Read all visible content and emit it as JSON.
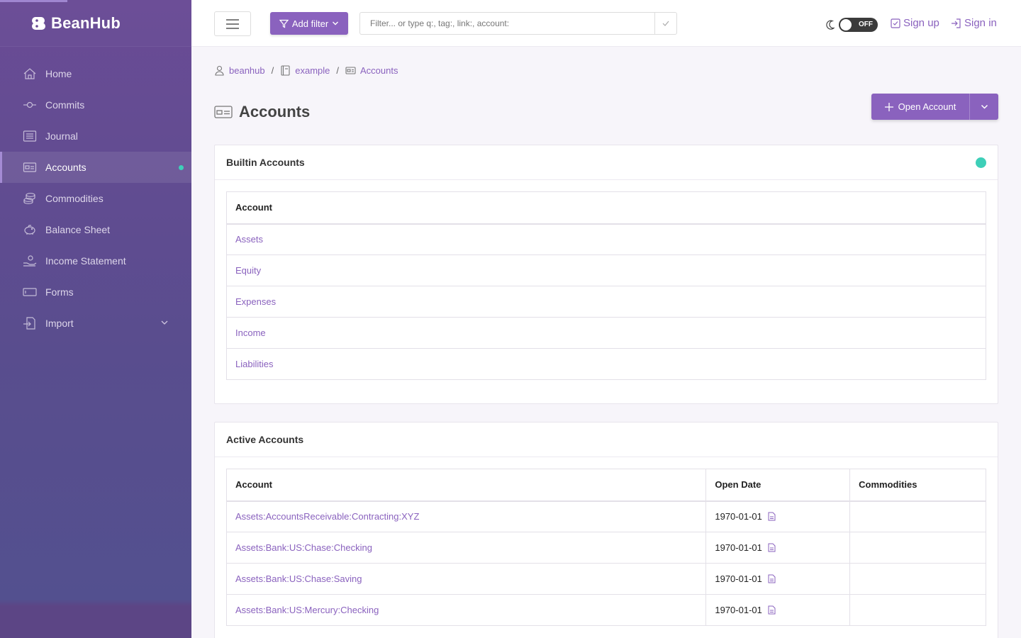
{
  "brand": {
    "name": "BeanHub"
  },
  "sidebar": {
    "items": [
      {
        "label": "Home",
        "icon": "home-icon"
      },
      {
        "label": "Commits",
        "icon": "commit-icon"
      },
      {
        "label": "Journal",
        "icon": "journal-icon"
      },
      {
        "label": "Accounts",
        "icon": "accounts-icon",
        "active": true
      },
      {
        "label": "Commodities",
        "icon": "coins-icon"
      },
      {
        "label": "Balance Sheet",
        "icon": "piggy-bank-icon"
      },
      {
        "label": "Income Statement",
        "icon": "hand-coin-icon"
      },
      {
        "label": "Forms",
        "icon": "form-icon"
      },
      {
        "label": "Import",
        "icon": "import-icon"
      }
    ]
  },
  "topbar": {
    "add_filter_label": "Add filter",
    "filter_placeholder": "Filter... or type q:, tag:, link:, account:",
    "theme_toggle_text": "OFF",
    "sign_up": "Sign up",
    "sign_in": "Sign in"
  },
  "breadcrumb": {
    "user": "beanhub",
    "repo": "example",
    "page": "Accounts"
  },
  "page": {
    "title": "Accounts",
    "open_account_label": "Open Account"
  },
  "builtin": {
    "title": "Builtin Accounts",
    "header": "Account",
    "rows": [
      "Assets",
      "Equity",
      "Expenses",
      "Income",
      "Liabilities"
    ]
  },
  "active": {
    "title": "Active Accounts",
    "headers": [
      "Account",
      "Open Date",
      "Commodities"
    ],
    "rows": [
      {
        "account": "Assets:AccountsReceivable:Contracting:XYZ",
        "open_date": "1970-01-01",
        "commodities": ""
      },
      {
        "account": "Assets:Bank:US:Chase:Checking",
        "open_date": "1970-01-01",
        "commodities": ""
      },
      {
        "account": "Assets:Bank:US:Chase:Saving",
        "open_date": "1970-01-01",
        "commodities": ""
      },
      {
        "account": "Assets:Bank:US:Mercury:Checking",
        "open_date": "1970-01-01",
        "commodities": ""
      }
    ]
  },
  "colors": {
    "accent": "#8a62be",
    "status": "#3ecfb8",
    "sidebar": "#5e4b92"
  }
}
